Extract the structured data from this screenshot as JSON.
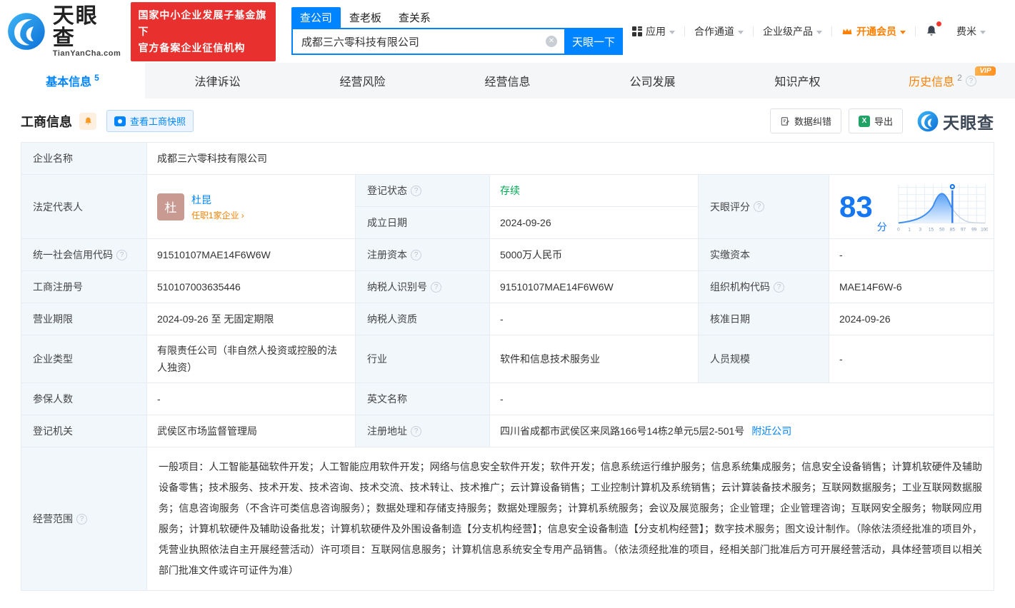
{
  "colors": {
    "brand_blue": "#0084ff",
    "vip_orange": "#ff8000",
    "status_green": "#00a854",
    "badge_red": "#e8312f",
    "score_blue": "#1677f2"
  },
  "header": {
    "logo_title": "天眼查",
    "logo_domain": "TianYanCha.com",
    "badge_line1": "国家中小企业发展子基金旗下",
    "badge_line2": "官方备案企业征信机构",
    "search_tabs": {
      "company": "查公司",
      "boss": "查老板",
      "relation": "查关系"
    },
    "search_value": "成都三六零科技有限公司",
    "search_button": "天眼一下",
    "nav": {
      "apps": "应用",
      "partner": "合作通道",
      "enterprise": "企业级产品",
      "vip": "开通会员",
      "user": "费米"
    }
  },
  "tabs": {
    "basic": "基本信息",
    "basic_count": "5",
    "legal": "法律诉讼",
    "risk": "经营风险",
    "operation": "经营信息",
    "development": "公司发展",
    "ip": "知识产权",
    "history": "历史信息",
    "history_count": "2",
    "history_vip": "VIP"
  },
  "section": {
    "title": "工商信息",
    "snapshot_button": "查看工商快照",
    "correction_button": "数据纠错",
    "export_button": "导出",
    "watermark": "天眼查"
  },
  "biz": {
    "company_name": {
      "label": "企业名称",
      "value": "成都三六零科技有限公司"
    },
    "legal_rep": {
      "label": "法定代表人",
      "avatar": "杜",
      "name": "杜昆",
      "positions": "任职1家企业"
    },
    "reg_status": {
      "label": "登记状态",
      "value": "存续"
    },
    "establish_date": {
      "label": "成立日期",
      "value": "2024-09-26"
    },
    "score": {
      "label": "天眼评分",
      "value": "83",
      "unit": "分"
    },
    "credit_code": {
      "label": "统一社会信用代码",
      "value": "91510107MAE14F6W6W"
    },
    "reg_capital": {
      "label": "注册资本",
      "value": "5000万人民币"
    },
    "paid_capital": {
      "label": "实缴资本",
      "value": "-"
    },
    "reg_number": {
      "label": "工商注册号",
      "value": "510107003635446"
    },
    "taxpayer_id": {
      "label": "纳税人识别号",
      "value": "91510107MAE14F6W6W"
    },
    "org_code": {
      "label": "组织机构代码",
      "value": "MAE14F6W-6"
    },
    "business_term": {
      "label": "营业期限",
      "value": "2024-09-26 至 无固定期限"
    },
    "taxpayer_quality": {
      "label": "纳税人资质",
      "value": "-"
    },
    "approval_date": {
      "label": "核准日期",
      "value": "2024-09-26"
    },
    "company_type": {
      "label": "企业类型",
      "value": "有限责任公司（非自然人投资或控股的法人独资）"
    },
    "industry": {
      "label": "行业",
      "value": "软件和信息技术服务业"
    },
    "staff_size": {
      "label": "人员规模",
      "value": "-"
    },
    "insured_count": {
      "label": "参保人数",
      "value": "-"
    },
    "english_name": {
      "label": "英文名称",
      "value": "-"
    },
    "reg_authority": {
      "label": "登记机关",
      "value": "武侯区市场监督管理局"
    },
    "reg_address": {
      "label": "注册地址",
      "value": "四川省成都市武侯区来凤路166号14栋2单元5层2-501号",
      "nearby_link": "附近公司"
    },
    "business_scope": {
      "label": "经营范围",
      "value": "一般项目：人工智能基础软件开发；人工智能应用软件开发；网络与信息安全软件开发；软件开发；信息系统运行维护服务；信息系统集成服务；信息安全设备销售；计算机软硬件及辅助设备零售；技术服务、技术开发、技术咨询、技术交流、技术转让、技术推广；云计算设备销售；工业控制计算机及系统销售；云计算装备技术服务；互联网数据服务；工业互联网数据服务；信息咨询服务（不含许可类信息咨询服务）；数据处理和存储支持服务；数据处理服务；计算机系统服务；会议及展览服务；企业管理；企业管理咨询；互联网安全服务；物联网应用服务；计算机软硬件及辅助设备批发；计算机软硬件及外围设备制造【分支机构经营】；信息安全设备制造【分支机构经营】；数字技术服务；图文设计制作。（除依法须经批准的项目外，凭营业执照依法自主开展经营活动）许可项目：互联网信息服务；计算机信息系统安全专用产品销售。（依法须经批准的项目，经相关部门批准后方可开展经营活动，具体经营项目以相关部门批准文件或许可证件为准）"
    }
  },
  "score_chart": {
    "type": "area",
    "description": "score distribution bell curve with marker pin at company score",
    "ticks": [
      "0",
      "1",
      "3",
      "15",
      "50",
      "85",
      "97",
      "99",
      "100"
    ],
    "marker_tick": "85",
    "score": 83
  }
}
